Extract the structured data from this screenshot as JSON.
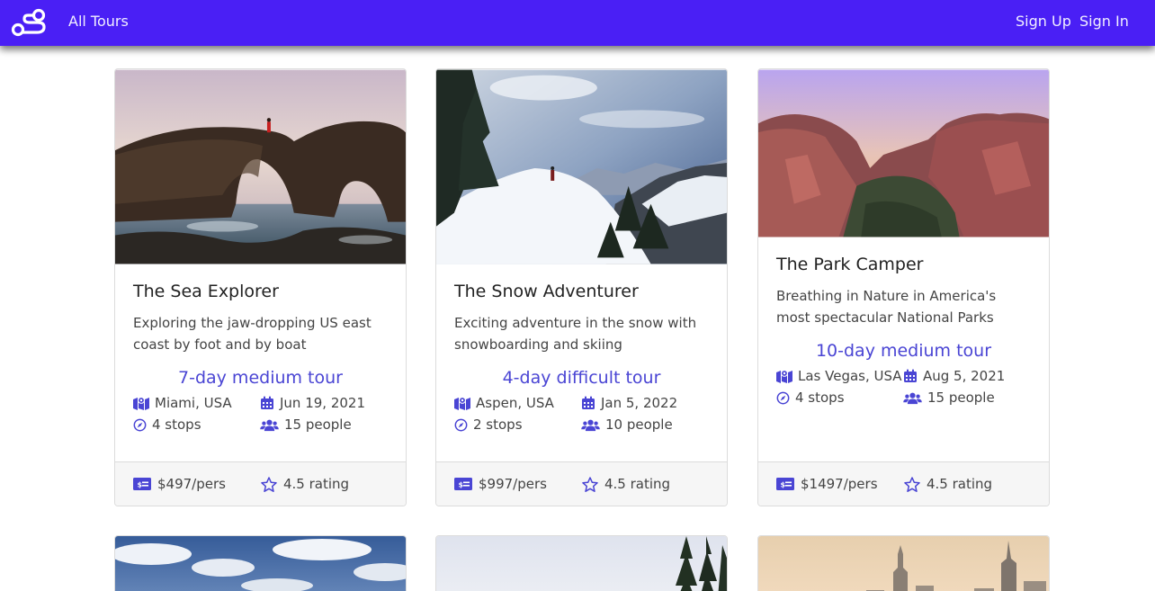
{
  "nav": {
    "all_tours": "All Tours",
    "sign_up": "Sign Up",
    "sign_in": "Sign In"
  },
  "colors": {
    "nav_bg": "#4a1ff5",
    "accent": "#4a45d4"
  },
  "tours": [
    {
      "title": "The Sea Explorer",
      "description": "Exploring the jaw-dropping US east coast by foot and by boat",
      "tour": "7-day medium tour",
      "location": "Miami, USA",
      "date": "Jun 19, 2021",
      "stops": "4 stops",
      "people": "15 people",
      "price": "$497/pers",
      "rating": "4.5 rating"
    },
    {
      "title": "The Snow Adventurer",
      "description": "Exciting adventure in the snow with snowboarding and skiing",
      "tour": "4-day difficult tour",
      "location": "Aspen, USA",
      "date": "Jan 5, 2022",
      "stops": "2 stops",
      "people": "10 people",
      "price": "$997/pers",
      "rating": "4.5 rating"
    },
    {
      "title": "The Park Camper",
      "description": "Breathing in Nature in America's most spectacular National Parks",
      "tour": "10-day medium tour",
      "location": "Las Vegas, USA",
      "date": "Aug 5, 2021",
      "stops": "4 stops",
      "people": "15 people",
      "price": "$1497/pers",
      "rating": "4.5 rating"
    }
  ],
  "icons": {
    "logo": "route-logo-icon",
    "location": "map-location-icon",
    "date": "calendar-icon",
    "stops": "compass-icon",
    "people": "users-icon",
    "price": "money-bill-icon",
    "rating": "star-icon"
  }
}
